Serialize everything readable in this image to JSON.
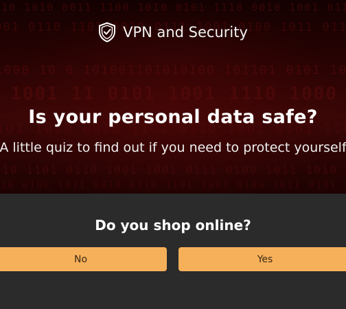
{
  "brand": {
    "name": "VPN and Security",
    "icon": "shield-check-icon"
  },
  "hero": {
    "title": "Is your personal data safe?",
    "subtitle": "A little quiz to find out if you need to protect yourself"
  },
  "quiz": {
    "question": "Do you shop online?",
    "answers": {
      "no": "No",
      "yes": "Yes"
    }
  },
  "colors": {
    "hero_background": "#2a0303",
    "quiz_background": "#2b2b2b",
    "button": "#f7b05a",
    "button_text": "#3a2a14"
  }
}
